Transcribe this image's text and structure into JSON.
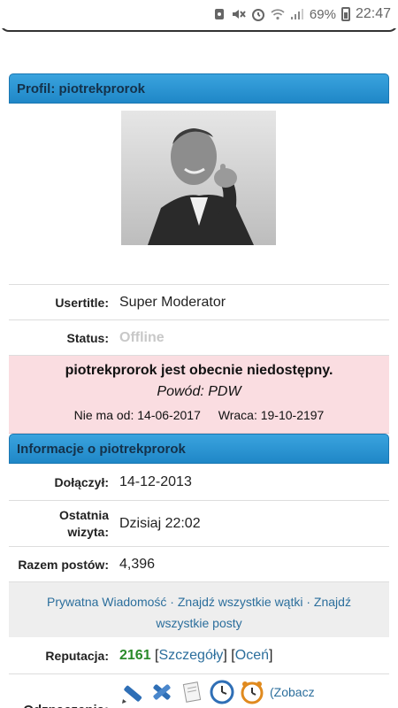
{
  "status_bar": {
    "battery": "69%",
    "time": "22:47",
    "icons": [
      "sim-icon",
      "mute-icon",
      "alarm-icon",
      "wifi-icon",
      "signal-icon",
      "battery-icon"
    ]
  },
  "profile": {
    "header": "Profil: piotrekprorok",
    "usertitle_label": "Usertitle:",
    "usertitle_value": "Super Moderator",
    "status_label": "Status:",
    "status_value": "Offline",
    "away_title": "piotrekprorok jest obecnie niedostępny.",
    "away_reason": "Powód: PDW",
    "away_from": "Nie ma od: 14-06-2017",
    "away_back": "Wraca: 19-10-2197"
  },
  "info": {
    "header": "Informacje o piotrekprorok",
    "joined_label": "Dołączył:",
    "joined_value": "14-12-2013",
    "last_visit_label_1": "Ostatnia",
    "last_visit_label_2": "wizyta:",
    "last_visit_value": "Dzisiaj 22:02",
    "posts_label": "Razem postów:",
    "posts_value": "4,396",
    "link_pm": "Prywatna Wiadomość",
    "link_threads": "Znajdź wszystkie wątki",
    "link_posts_1": "Znajdź",
    "link_posts_2": "wszystkie posty",
    "rep_label": "Reputacja:",
    "rep_value": "2161",
    "rep_details": "Szczegóły",
    "rep_rate": "Oceń",
    "badges_label": "Odznaczenia:",
    "badges_more": "(Zobacz"
  },
  "colors": {
    "header_blue": "#2993d4",
    "away_bg": "#fadde1",
    "rep_green": "#2a8a2a",
    "link_blue": "#2b6e9c"
  }
}
